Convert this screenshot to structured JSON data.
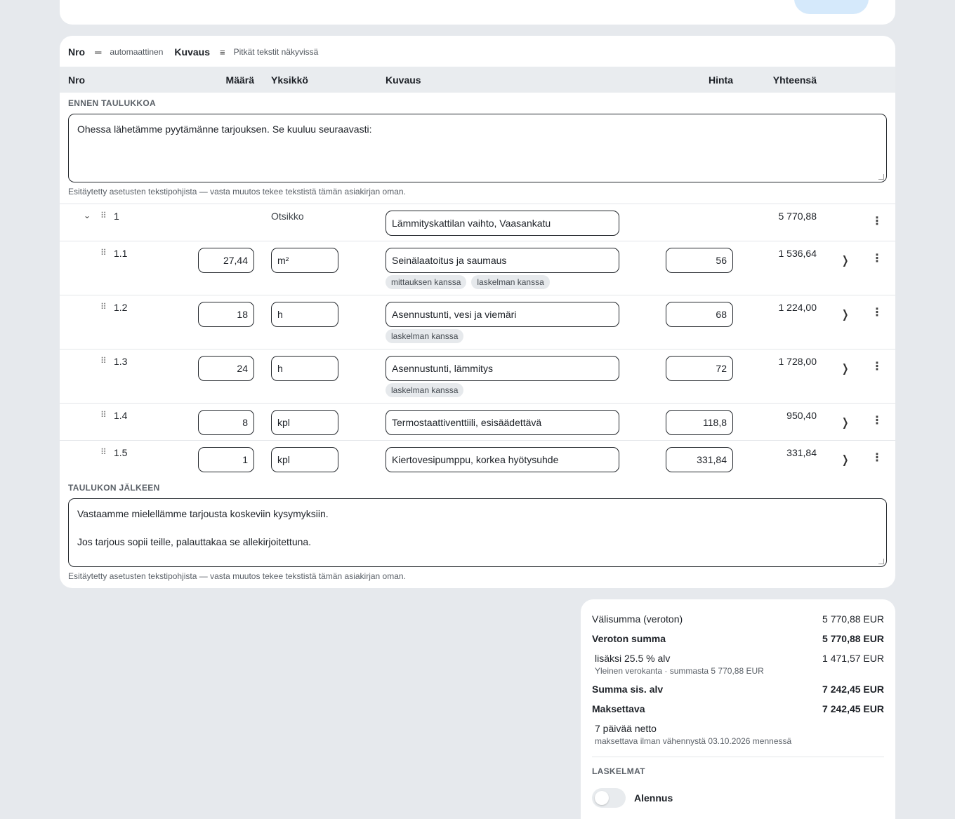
{
  "options": {
    "nro_label": "Nro",
    "nro_icon": "equals-icon",
    "nro_value": "automaattinen",
    "kuvaus_label": "Kuvaus",
    "kuvaus_icon": "menu-icon",
    "kuvaus_value": "Pitkät tekstit näkyvissä"
  },
  "table_header": {
    "nro": "Nro",
    "maara": "Määrä",
    "yksikko": "Yksikkö",
    "kuvaus": "Kuvaus",
    "hinta": "Hinta",
    "yhteensa": "Yhteensä"
  },
  "before": {
    "label": "ENNEN TAULUKKOA",
    "text": "Ohessa lähetämme pyytämänne tarjouksen. Se kuuluu seuraavasti:",
    "hint": "Esitäytetty asetusten tekstipohjista — vasta muutos tekee tekstistä tämän asiakirjan oman."
  },
  "group": {
    "nro": "1",
    "kind": "Otsikko",
    "description": "Lämmityskattilan vaihto, Vaasankatu",
    "total": "5 770,88"
  },
  "rows": [
    {
      "nro": "1.1",
      "qty": "27,44",
      "unit": "m²",
      "description": "Seinälaatoitus ja saumaus",
      "price": "56",
      "total": "1 536,64",
      "tags": [
        "mittauksen kanssa",
        "laskelman kanssa"
      ]
    },
    {
      "nro": "1.2",
      "qty": "18",
      "unit": "h",
      "description": "Asennustunti, vesi ja viemäri",
      "price": "68",
      "total": "1 224,00",
      "tags": [
        "laskelman kanssa"
      ]
    },
    {
      "nro": "1.3",
      "qty": "24",
      "unit": "h",
      "description": "Asennustunti, lämmitys",
      "price": "72",
      "total": "1 728,00",
      "tags": [
        "laskelman kanssa"
      ]
    },
    {
      "nro": "1.4",
      "qty": "8",
      "unit": "kpl",
      "description": "Termostaattiventtiili, esisäädettävä",
      "price": "118,8",
      "total": "950,40",
      "tags": []
    },
    {
      "nro": "1.5",
      "qty": "1",
      "unit": "kpl",
      "description": "Kiertovesipumppu, korkea hyötysuhde",
      "price": "331,84",
      "total": "331,84",
      "tags": []
    }
  ],
  "after": {
    "label": "TAULUKON JÄLKEEN",
    "text": "Vastaamme mielellämme tarjousta koskeviin kysymyksiin.\n\nJos tarjous sopii teille, palauttakaa se allekirjoitettuna.",
    "hint": "Esitäytetty asetusten tekstipohjista — vasta muutos tekee tekstistä tämän asiakirjan oman."
  },
  "summary": {
    "subtotal_label": "Välisumma (veroton)",
    "subtotal_value": "5 770,88 EUR",
    "net_label": "Veroton summa",
    "net_value": "5 770,88 EUR",
    "vat_label": "lisäksi 25.5 % alv",
    "vat_value": "1 471,57 EUR",
    "vat_sub": "Yleinen verokanta · summasta 5 770,88 EUR",
    "gross_label": "Summa sis. alv",
    "gross_value": "7 242,45 EUR",
    "payable_label": "Maksettava",
    "payable_value": "7 242,45 EUR",
    "terms": "7 päivää netto",
    "terms_sub": "maksettava ilman vähennystä 03.10.2026 mennessä",
    "calc_label": "LASKELMAT",
    "discount_label": "Alennus",
    "discount_enabled": false
  }
}
